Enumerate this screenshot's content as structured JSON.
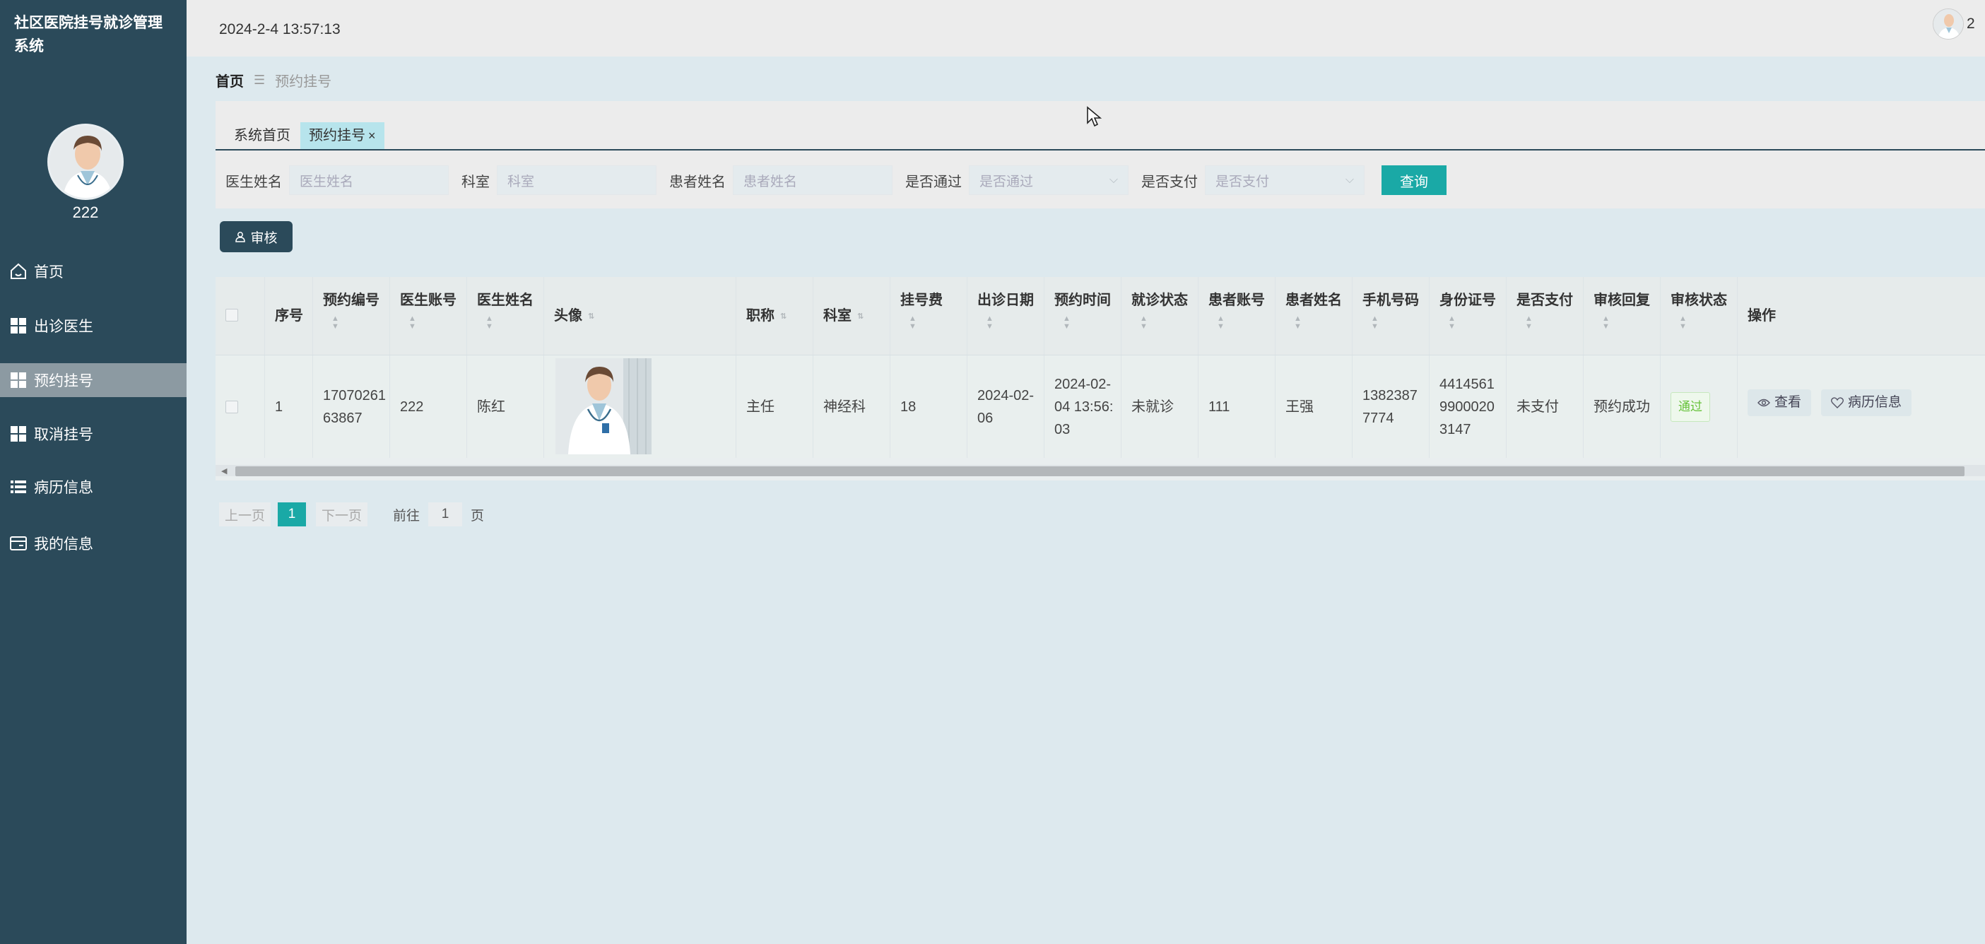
{
  "sidebar": {
    "app_title": "社区医院挂号就诊管理系统",
    "user_name": "222",
    "items": [
      {
        "label": "首页",
        "icon": "home-icon"
      },
      {
        "label": "出诊医生",
        "icon": "grid-icon"
      },
      {
        "label": "预约挂号",
        "icon": "grid-icon",
        "active": true
      },
      {
        "label": "取消挂号",
        "icon": "grid-icon"
      },
      {
        "label": "病历信息",
        "icon": "list-icon"
      },
      {
        "label": "我的信息",
        "icon": "card-icon"
      }
    ]
  },
  "topbar": {
    "datetime": "2024-2-4 13:57:13",
    "user": "2"
  },
  "breadcrumb": {
    "home": "首页",
    "current": "预约挂号"
  },
  "tabs": [
    {
      "label": "系统首页"
    },
    {
      "label": "预约挂号",
      "active": true,
      "close": "×"
    }
  ],
  "search": {
    "doctor_name_label": "医生姓名",
    "doctor_name_placeholder": "医生姓名",
    "department_label": "科室",
    "department_placeholder": "科室",
    "patient_name_label": "患者姓名",
    "patient_name_placeholder": "患者姓名",
    "approved_label": "是否通过",
    "approved_placeholder": "是否通过",
    "paid_label": "是否支付",
    "paid_placeholder": "是否支付",
    "query_label": "查询"
  },
  "toolbar": {
    "audit_label": "审核"
  },
  "table": {
    "headers": {
      "index": "序号",
      "appt_no": "预约编号",
      "doctor_account": "医生账号",
      "doctor_name": "医生姓名",
      "avatar": "头像",
      "title": "职称",
      "department": "科室",
      "fee": "挂号费",
      "visit_date": "出诊日期",
      "appt_time": "预约时间",
      "visit_status": "就诊状态",
      "patient_account": "患者账号",
      "patient_name": "患者姓名",
      "phone": "手机号码",
      "id_card": "身份证号",
      "paid": "是否支付",
      "audit_reply": "审核回复",
      "audit_status": "审核状态",
      "actions": "操作"
    },
    "rows": [
      {
        "index": "1",
        "appt_no": "1707026163867",
        "doctor_account": "222",
        "doctor_name": "陈红",
        "title": "主任",
        "department": "神经科",
        "fee": "18",
        "visit_date": "2024-02-06",
        "appt_time": "2024-02-04 13:56:03",
        "visit_status": "未就诊",
        "patient_account": "111",
        "patient_name": "王强",
        "phone": "13823877774",
        "id_card": "441456199000203147",
        "paid": "未支付",
        "audit_reply": "预约成功",
        "audit_status": "通过",
        "view_label": "查看",
        "record_label": "病历信息"
      }
    ]
  },
  "pager": {
    "prev": "上一页",
    "current": "1",
    "next": "下一页",
    "goto": "前往",
    "goto_value": "1",
    "unit": "页"
  },
  "colors": {
    "sidebar_bg": "#2b4a5a",
    "accent": "#1aa9a6",
    "page_bg": "#dde9ee"
  }
}
